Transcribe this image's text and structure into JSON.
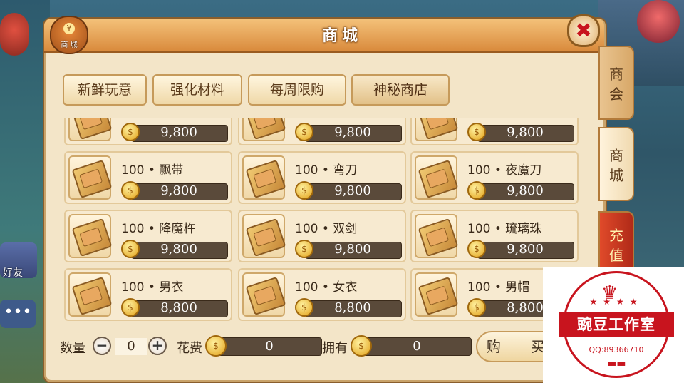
{
  "window": {
    "title": "商城",
    "badge_label": "商 城",
    "close_symbol": "✖"
  },
  "tabs": [
    {
      "label": "新鲜玩意",
      "active": false
    },
    {
      "label": "强化材料",
      "active": false
    },
    {
      "label": "每周限购",
      "active": false
    },
    {
      "label": "神秘商店",
      "active": true
    }
  ],
  "items": [
    {
      "name": "",
      "price": "9,800"
    },
    {
      "name": "",
      "price": "9,800"
    },
    {
      "name": "",
      "price": "9,800"
    },
    {
      "name": "100 • 飘带",
      "price": "9,800"
    },
    {
      "name": "100 • 弯刀",
      "price": "9,800"
    },
    {
      "name": "100 • 夜魔刀",
      "price": "9,800"
    },
    {
      "name": "100 • 降魔杵",
      "price": "9,800"
    },
    {
      "name": "100 • 双剑",
      "price": "9,800"
    },
    {
      "name": "100 • 琉璃珠",
      "price": "9,800"
    },
    {
      "name": "100 • 男衣",
      "price": "8,800"
    },
    {
      "name": "100 • 女衣",
      "price": "8,800"
    },
    {
      "name": "100 • 男帽",
      "price": "8,800"
    }
  ],
  "bottom": {
    "qty_label": "数量",
    "minus": "−",
    "qty_value": "0",
    "plus": "+",
    "cost_label": "花费",
    "cost_value": "0",
    "own_label": "拥有",
    "own_value": "0",
    "buy_label": "购 买"
  },
  "side_tabs": [
    {
      "label": "商会"
    },
    {
      "label": "商城"
    },
    {
      "label": "充值"
    }
  ],
  "background": {
    "friend_label": "好友",
    "chat_symbol": "•••"
  },
  "watermark": {
    "crown": "♛",
    "stars": "★★★★",
    "name": "豌豆工作室",
    "qq": "QQ:89366710",
    "base": "▬▬"
  },
  "colors": {
    "accent": "#d98a3c",
    "panel": "#f3e5c8",
    "price_bar": "#5a4a3a",
    "watermark_red": "#c8141e"
  },
  "icons": {
    "coin": "gold-coin-icon",
    "scroll": "equipment-scroll-icon",
    "close": "close-icon"
  }
}
